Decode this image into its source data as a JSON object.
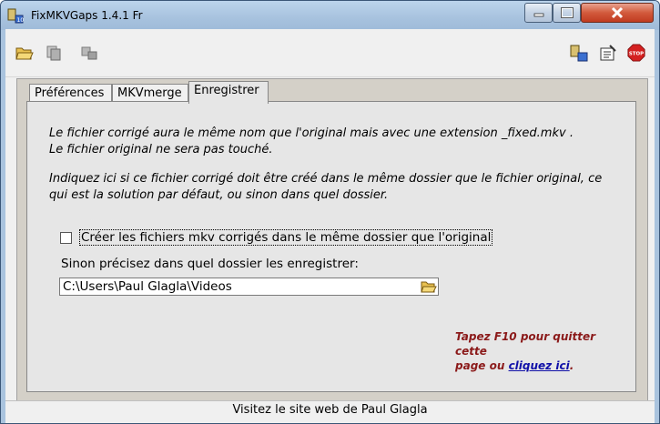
{
  "window": {
    "title": "FixMKVGaps 1.4.1 Fr",
    "controls": [
      "minimize",
      "maximize",
      "close"
    ]
  },
  "toolbar": {
    "left_icons": [
      "open-folder-icon",
      "copy-files-icon",
      "tools-icon"
    ],
    "right_icons": [
      "app-info-icon",
      "settings-icon",
      "stop-icon"
    ],
    "stop_label": "STOP"
  },
  "tabs": [
    {
      "label": "Préférences",
      "active": false
    },
    {
      "label": "MKVmerge",
      "active": false
    },
    {
      "label": "Enregistrer",
      "active": true
    }
  ],
  "content": {
    "para1_line1": "Le fichier corrigé aura le même nom que l'original mais avec une extension _fixed.mkv .",
    "para1_line2": "Le fichier original ne sera pas touché.",
    "para2_line1": "Indiquez ici si ce fichier corrigé doit être créé dans le même dossier que le fichier original, ce",
    "para2_line2": "qui est la solution par défaut, ou sinon dans quel dossier.",
    "checkbox_label": "Créer les fichiers mkv corrigés dans le même dossier que l'original",
    "checkbox_checked": false,
    "folder_prompt": "Sinon précisez dans quel dossier les enregistrer:",
    "folder_path": "C:\\Users\\Paul Glagla\\Videos",
    "quit_note_line1": "Tapez F10 pour quitter cette",
    "quit_note_prefix": "page ou ",
    "quit_link": "cliquez ici",
    "quit_note_suffix": "."
  },
  "status": {
    "link_text": "Visitez le site web de Paul Glagla"
  },
  "colors": {
    "titlebar": "#a7c2de",
    "close_button": "#c13b20",
    "quit_note": "#8b1a1a",
    "link": "#1010a8"
  }
}
